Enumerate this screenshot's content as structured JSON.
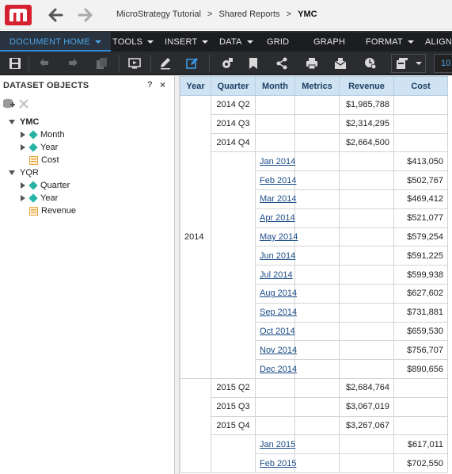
{
  "breadcrumb": {
    "items": [
      "MicroStrategy Tutorial",
      "Shared Reports"
    ],
    "current": "YMC"
  },
  "menubar": {
    "items": [
      {
        "label": "DOCUMENT HOME",
        "dropdown": true,
        "active": true
      },
      {
        "label": "TOOLS",
        "dropdown": true
      },
      {
        "label": "INSERT",
        "dropdown": true
      },
      {
        "label": "DATA",
        "dropdown": true
      },
      {
        "label": "GRID",
        "dropdown": false
      },
      {
        "label": "GRAPH",
        "dropdown": false
      },
      {
        "label": "FORMAT",
        "dropdown": true
      },
      {
        "label": "ALIGN",
        "dropdown": false
      }
    ]
  },
  "toolbar": {
    "zoom": "10"
  },
  "panel": {
    "title": "DATASET OBJECTS",
    "help": "?",
    "close": "×",
    "tree": [
      {
        "label": "YMC",
        "type": "dataset",
        "level": 0,
        "bold": true
      },
      {
        "label": "Month",
        "type": "attribute",
        "level": 1
      },
      {
        "label": "Year",
        "type": "attribute",
        "level": 1
      },
      {
        "label": "Cost",
        "type": "metric",
        "level": 1
      },
      {
        "label": "YQR",
        "type": "dataset",
        "level": 0,
        "bold": false
      },
      {
        "label": "Quarter",
        "type": "attribute",
        "level": 1
      },
      {
        "label": "Year",
        "type": "attribute",
        "level": 1
      },
      {
        "label": "Revenue",
        "type": "metric",
        "level": 1
      }
    ]
  },
  "grid": {
    "headers": [
      "Year",
      "Quarter",
      "Month",
      "Metrics",
      "Revenue",
      "Cost"
    ],
    "year_2014": "2014",
    "rows": [
      {
        "quarter": "2014 Q2",
        "month": "",
        "revenue": "$1,985,788",
        "cost": ""
      },
      {
        "quarter": "2014 Q3",
        "month": "",
        "revenue": "$2,314,295",
        "cost": ""
      },
      {
        "quarter": "2014 Q4",
        "month": "",
        "revenue": "$2,664,500",
        "cost": ""
      },
      {
        "quarter": "",
        "month": "Jan 2014",
        "revenue": "",
        "cost": "$413,050"
      },
      {
        "quarter": "",
        "month": "Feb 2014",
        "revenue": "",
        "cost": "$502,767"
      },
      {
        "quarter": "",
        "month": "Mar 2014",
        "revenue": "",
        "cost": "$469,412"
      },
      {
        "quarter": "",
        "month": "Apr 2014",
        "revenue": "",
        "cost": "$521,077"
      },
      {
        "quarter": "",
        "month": "May 2014",
        "revenue": "",
        "cost": "$579,254"
      },
      {
        "quarter": "",
        "month": "Jun 2014",
        "revenue": "",
        "cost": "$591,225"
      },
      {
        "quarter": "",
        "month": "Jul 2014",
        "revenue": "",
        "cost": "$599,938"
      },
      {
        "quarter": "",
        "month": "Aug 2014",
        "revenue": "",
        "cost": "$627,602"
      },
      {
        "quarter": "",
        "month": "Sep 2014",
        "revenue": "",
        "cost": "$731,881"
      },
      {
        "quarter": "",
        "month": "Oct 2014",
        "revenue": "",
        "cost": "$659,530"
      },
      {
        "quarter": "",
        "month": "Nov 2014",
        "revenue": "",
        "cost": "$756,707"
      },
      {
        "quarter": "",
        "month": "Dec 2014",
        "revenue": "",
        "cost": "$890,656"
      },
      {
        "quarter": "2015 Q2",
        "month": "",
        "revenue": "$2,684,764",
        "cost": ""
      },
      {
        "quarter": "2015 Q3",
        "month": "",
        "revenue": "$3,067,019",
        "cost": ""
      },
      {
        "quarter": "2015 Q4",
        "month": "",
        "revenue": "$3,267,067",
        "cost": ""
      },
      {
        "quarter": "",
        "month": "Jan 2015",
        "revenue": "",
        "cost": "$617,011"
      },
      {
        "quarter": "",
        "month": "Feb 2015",
        "revenue": "",
        "cost": "$702,550"
      }
    ]
  },
  "colors": {
    "brand_red": "#d5202f",
    "menubar_bg": "#1c1d20",
    "accent_blue": "#2d8bd7",
    "header_bg": "#cfe3f3",
    "attribute_teal": "#27b3a6",
    "metric_orange": "#e8a23a"
  }
}
